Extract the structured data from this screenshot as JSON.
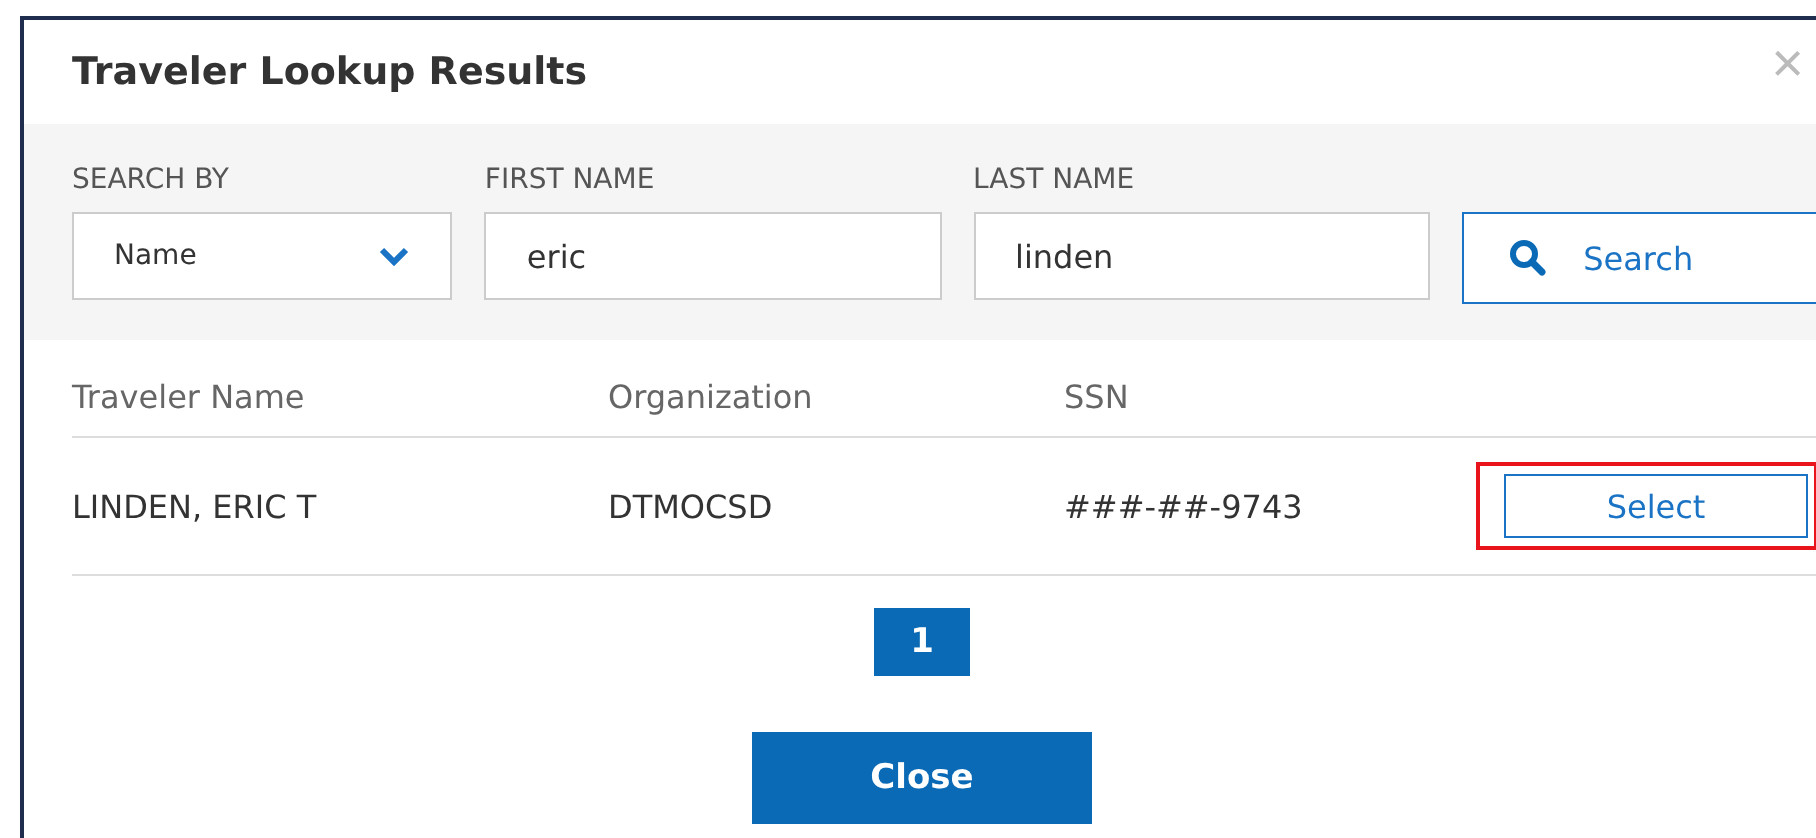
{
  "dialog": {
    "title": "Traveler Lookup Results",
    "close_icon": "×"
  },
  "search": {
    "fields": [
      {
        "kind": "select",
        "label": "SEARCH BY",
        "value": "Name"
      },
      {
        "kind": "text",
        "label": "FIRST NAME",
        "value": "eric"
      },
      {
        "kind": "text",
        "label": "LAST NAME",
        "value": "linden"
      }
    ],
    "button": "Search"
  },
  "table": {
    "columns": [
      "Traveler Name",
      "Organization",
      "SSN"
    ],
    "rows": [
      {
        "cells": [
          "LINDEN, ERIC T",
          "DTMOCSD",
          "###-##-9743"
        ],
        "action": "Select",
        "highlighted": true
      }
    ]
  },
  "pagination": [
    {
      "label": "1",
      "selected": true
    }
  ],
  "footer_button": "Close"
}
